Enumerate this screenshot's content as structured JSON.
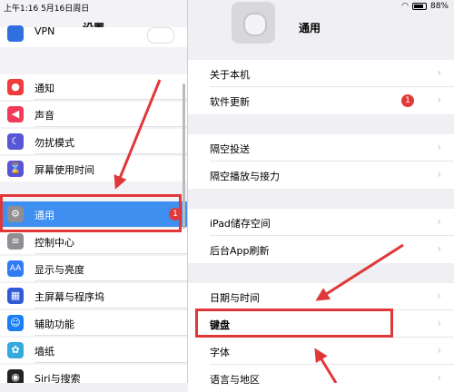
{
  "status": {
    "time_date": "上午1:16  5月16日周日",
    "battery": "88%"
  },
  "left": {
    "title": "设置",
    "top_partial": "VPN",
    "items": [
      {
        "label": "通知",
        "icon": "bell-icon",
        "color": "#f23b3b"
      },
      {
        "label": "声音",
        "icon": "speaker-icon",
        "color": "#f23b5b"
      },
      {
        "label": "勿扰模式",
        "icon": "moon-icon",
        "color": "#5856d6"
      },
      {
        "label": "屏幕使用时间",
        "icon": "hourglass-icon",
        "color": "#5856d6"
      },
      {
        "label": "通用",
        "icon": "gear-icon",
        "color": "#8e8e93",
        "badge": "1"
      },
      {
        "label": "控制中心",
        "icon": "switches-icon",
        "color": "#8e8e93"
      },
      {
        "label": "显示与亮度",
        "icon": "aa-icon",
        "color": "#2f7cf6"
      },
      {
        "label": "主屏幕与程序坞",
        "icon": "grid-icon",
        "color": "#2f5bd6"
      },
      {
        "label": "辅助功能",
        "icon": "accessibility-icon",
        "color": "#1a7ef7"
      },
      {
        "label": "墙纸",
        "icon": "flower-icon",
        "color": "#35aadc"
      },
      {
        "label": "Siri与搜索",
        "icon": "siri-icon",
        "color": "#222"
      }
    ]
  },
  "right": {
    "title": "通用",
    "groups": [
      [
        {
          "label": "关于本机"
        },
        {
          "label": "软件更新",
          "badge": "1"
        }
      ],
      [
        {
          "label": "隔空投送"
        },
        {
          "label": "隔空播放与接力"
        }
      ],
      [
        {
          "label": "iPad储存空间"
        },
        {
          "label": "后台App刷新"
        }
      ],
      [
        {
          "label": "日期与时间"
        },
        {
          "label": "键盘"
        },
        {
          "label": "字体"
        },
        {
          "label": "语言与地区"
        }
      ]
    ]
  },
  "colors": {
    "accent": "#3e8ff0",
    "annotation": "#e03838"
  }
}
